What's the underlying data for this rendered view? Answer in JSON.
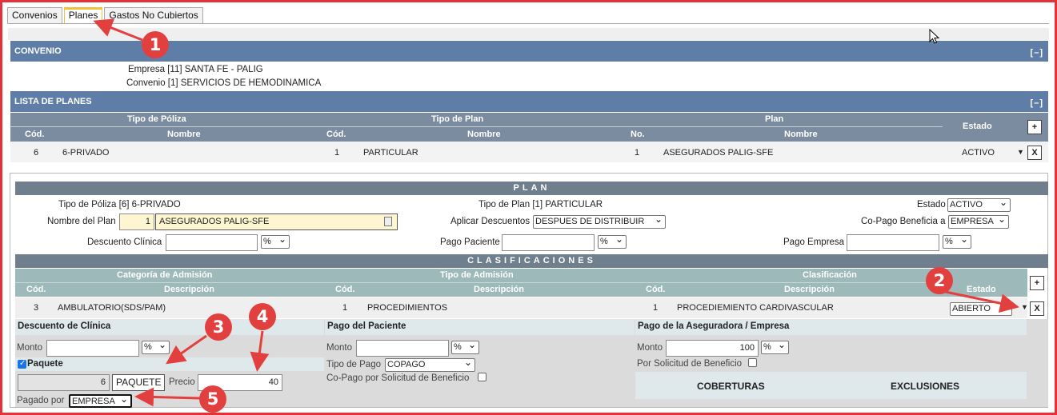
{
  "tabs": [
    "Convenios",
    "Planes",
    "Gastos No Cubiertos"
  ],
  "convenio": {
    "title": "CONVENIO",
    "collapse": "[–]",
    "empresa": "Empresa [11] SANTA FE - PALIG",
    "convenio": "Convenio [1] SERVICIOS DE HEMODINAMICA"
  },
  "lista": {
    "title": "LISTA DE PLANES",
    "collapse": "[–]",
    "group_headers": [
      "Tipo de Póliza",
      "Tipo de Plan",
      "Plan"
    ],
    "estado_header": "Estado",
    "col_headers": [
      "Cód.",
      "Nombre",
      "Cód.",
      "Nombre",
      "No.",
      "Nombre"
    ],
    "add_label": "+",
    "row": {
      "cod1": "6",
      "nombre1": "6-PRIVADO",
      "cod2": "1",
      "nombre2": "PARTICULAR",
      "no": "1",
      "nombre3": "ASEGURADOS PALIG-SFE",
      "estado": "ACTIVO",
      "caret": "▼",
      "del": "X"
    }
  },
  "plan": {
    "title": "PLAN",
    "tipo_poliza": "Tipo de Póliza [6] 6-PRIVADO",
    "tipo_plan": "Tipo de Plan [1] PARTICULAR",
    "estado_label": "Estado",
    "estado_value": "ACTIVO",
    "nombre_label": "Nombre del Plan",
    "nombre_num": "1",
    "nombre_value": "ASEGURADOS PALIG-SFE",
    "aplicar_label": "Aplicar Descuentos",
    "aplicar_value": "DESPUES DE DISTRIBUIR",
    "copago_label": "Co-Pago Beneficia a",
    "copago_value": "EMPRESA",
    "desc_clinica_label": "Descuento Clínica",
    "pago_paciente_label": "Pago Paciente",
    "pago_empresa_label": "Pago Empresa",
    "pct": "%"
  },
  "clasif": {
    "title": "CLASIFICACIONES",
    "group_headers": [
      "Categoría de Admisión",
      "Tipo de Admisión",
      "Clasificación"
    ],
    "estado_header": "Estado",
    "col_headers": [
      "Cód.",
      "Descripción",
      "Cód.",
      "Descripción",
      "Cód.",
      "Descripción"
    ],
    "add_label": "+",
    "row": {
      "cod1": "3",
      "desc1": "AMBULATORIO(SDS/PAM)",
      "cod2": "1",
      "desc2": "PROCEDIMIENTOS",
      "cod3": "1",
      "desc3": "PROCEDIEMIENTO CARDIVASCULAR",
      "estado": "ABIERTO",
      "caret": "▼",
      "del": "X"
    }
  },
  "detalle": {
    "desc_title": "Descuento de Clínica",
    "monto_label": "Monto",
    "pct": "%",
    "paquete_label": "Paquete",
    "paquete_num": "6",
    "paquete_btn": "PAQUETE",
    "precio_label": "Precio",
    "precio_value": "40",
    "pagado_label": "Pagado por",
    "pagado_value": "EMPRESA",
    "paciente_title": "Pago del Paciente",
    "tipo_pago_label": "Tipo de Pago",
    "tipo_pago_value": "COPAGO",
    "copago_solicitud_label": "Co-Pago por Solicitud de Beneficio",
    "aseg_title": "Pago de la Aseguradora / Empresa",
    "aseg_monto_value": "100",
    "solicitud_label": "Por Solicitud de Beneficio",
    "coberturas": "COBERTURAS",
    "exclusiones": "EXCLUSIONES"
  },
  "callouts": [
    "1",
    "2",
    "3",
    "4",
    "5"
  ],
  "colors": {
    "accent_red": "#e2403f",
    "section_blue": "#5f7ea7",
    "teal_header": "#9db9b9"
  }
}
